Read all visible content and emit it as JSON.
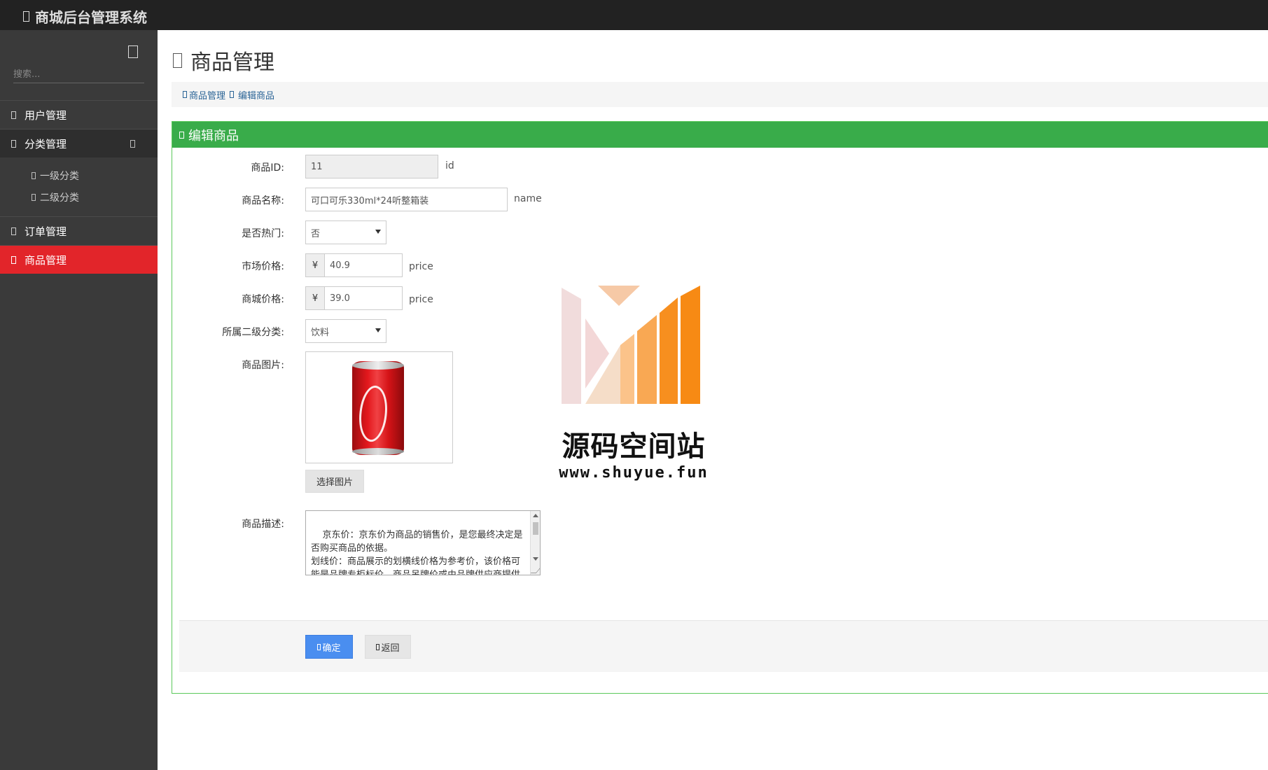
{
  "app": {
    "title": "商城后台管理系统"
  },
  "sidebar": {
    "search_placeholder": "搜索...",
    "items": [
      {
        "label": "用户管理"
      },
      {
        "label": "分类管理",
        "children": [
          {
            "label": "一级分类"
          },
          {
            "label": "二级分类"
          }
        ]
      },
      {
        "label": "订单管理"
      },
      {
        "label": "商品管理"
      }
    ]
  },
  "page": {
    "title": "商品管理"
  },
  "breadcrumb": {
    "items": [
      "商品管理",
      "编辑商品"
    ]
  },
  "panel": {
    "title": "编辑商品"
  },
  "form": {
    "id": {
      "label": "商品ID:",
      "value": "11",
      "hint": "id"
    },
    "name": {
      "label": "商品名称:",
      "value": "可口可乐330ml*24听整箱装",
      "hint": "name"
    },
    "hot": {
      "label": "是否热门:",
      "value": "否"
    },
    "market_price": {
      "label": "市场价格:",
      "currency": "¥",
      "value": "40.9",
      "hint": "price"
    },
    "shop_price": {
      "label": "商城价格:",
      "currency": "¥",
      "value": "39.0",
      "hint": "price"
    },
    "category": {
      "label": "所属二级分类:",
      "value": "饮料"
    },
    "image": {
      "label": "商品图片:",
      "button": "选择图片"
    },
    "desc": {
      "label": "商品描述:",
      "value": "京东价：京东价为商品的销售价，是您最终决定是否购买商品的依据。\n划线价：商品展示的划横线价格为参考价，该价格可能是品牌专柜标价、商品吊牌价或由品牌供应商提供的正品零售价（如厂商指导价、建议零售价等）"
    }
  },
  "actions": {
    "confirm": "确定",
    "back": "返回"
  },
  "watermark": {
    "name": "源码空间站",
    "url": "www.shuyue.fun"
  },
  "colors": {
    "topbar": "#222222",
    "sidebar": "#3a3a3a",
    "active": "#e2252a",
    "panel_head": "#39ac4a",
    "primary": "#4a8ef0"
  }
}
